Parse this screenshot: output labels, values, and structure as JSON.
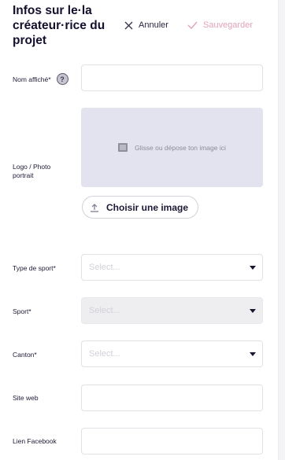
{
  "header": {
    "title": "Infos sur le·la créateur·rice du projet",
    "cancel_label": "Annuler",
    "save_label": "Sauvegarder"
  },
  "form": {
    "display_name": {
      "label": "Nom affiché*",
      "help": "?",
      "value": ""
    },
    "logo": {
      "label": "Logo / Photo portrait",
      "dropzone_text": "Glisse ou dépose ton image ici",
      "choose_button": "Choisir une image"
    },
    "sport_type": {
      "label": "Type de sport*",
      "placeholder": "Select..."
    },
    "sport": {
      "label": "Sport*",
      "placeholder": "Select..."
    },
    "canton": {
      "label": "Canton*",
      "placeholder": "Select..."
    },
    "website": {
      "label": "Site web",
      "value": ""
    },
    "facebook": {
      "label": "Lien Facebook",
      "value": ""
    }
  },
  "colors": {
    "save_disabled": "#e3a3b4",
    "dropzone_bg": "#e2e3ee",
    "text": "#1b1530"
  }
}
